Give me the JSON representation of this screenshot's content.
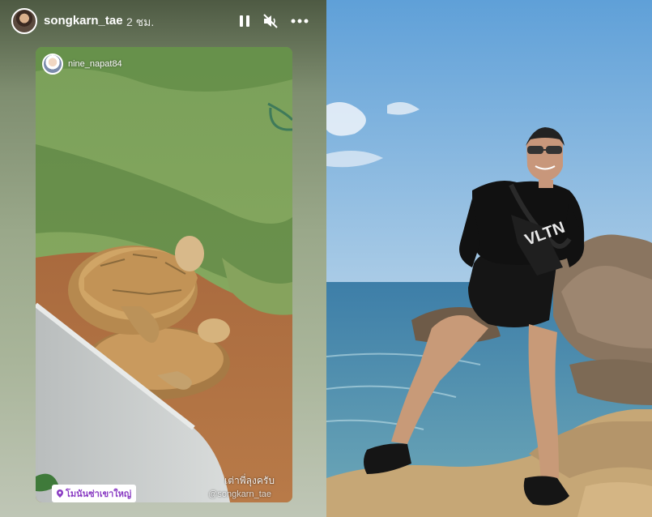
{
  "story": {
    "username": "songkarn_tae",
    "timestamp": "2 ชม.",
    "icons": [
      "pause-icon",
      "mute-icon",
      "more-icon"
    ],
    "repost": {
      "username": "nine_napat84",
      "caption": "เต่าพี่ลุงครับ",
      "credit": "@songkarn_tae",
      "location": "โมนันซ่าเขาใหญ่"
    }
  },
  "colors": {
    "location_text": "#8a3cc3",
    "sky": "#7fb6e0",
    "sea": "#4f8fb0"
  }
}
